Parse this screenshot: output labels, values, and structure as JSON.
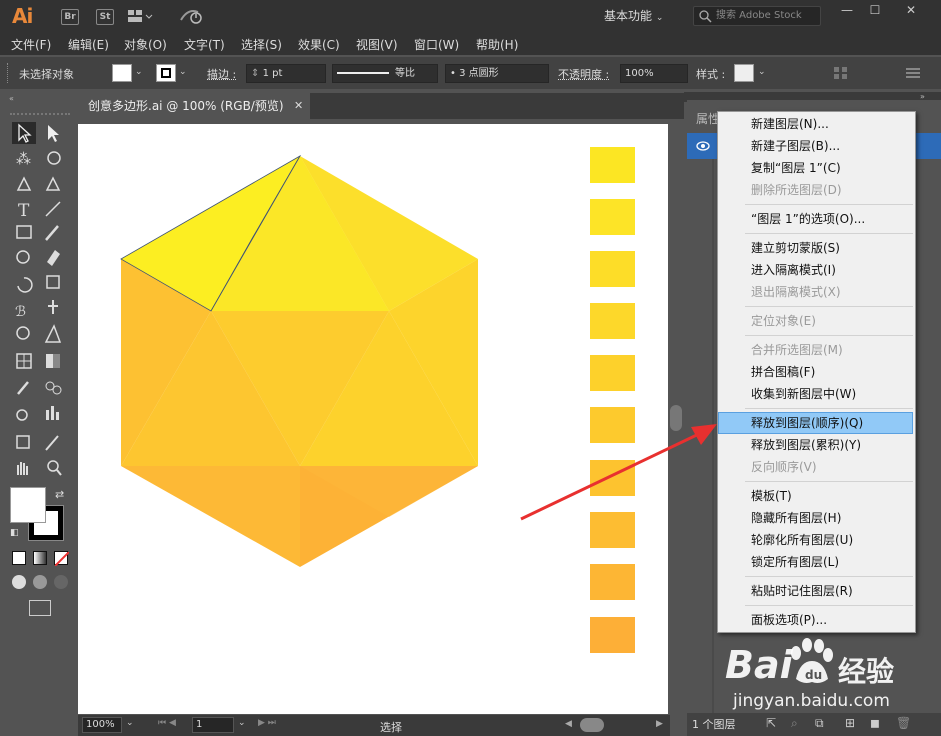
{
  "app": {
    "logo": "Ai",
    "bridge_label": "Br",
    "stock_label": "St",
    "workspace": "基本功能",
    "search_placeholder": "搜索 Adobe Stock",
    "minimize": "—",
    "maximize": "☐",
    "close": "✕"
  },
  "menubar": {
    "items": [
      "文件(F)",
      "编辑(E)",
      "对象(O)",
      "文字(T)",
      "选择(S)",
      "效果(C)",
      "视图(V)",
      "窗口(W)",
      "帮助(H)"
    ]
  },
  "controlbar": {
    "selection_status": "未选择对象",
    "stroke_label": "描边 :",
    "stroke_weight": "1 pt",
    "stroke_profile": "等比",
    "brush": "3 点圆形",
    "opacity_label": "不透明度 :",
    "opacity_value": "100%",
    "style_label": "样式 :"
  },
  "document": {
    "tab_title": "创意多边形.ai @ 100% (RGB/预览)",
    "tab_close": "✕"
  },
  "statusbar": {
    "zoom": "100%",
    "artboard_number": "1",
    "tool_status": "选择"
  },
  "layers_panel": {
    "tab_label": "属性",
    "layer_count": "1 个图层"
  },
  "context_menu": {
    "items": [
      {
        "label": "新建图层(N)...",
        "disabled": false
      },
      {
        "label": "新建子图层(B)...",
        "disabled": false
      },
      {
        "label": "复制“图层 1”(C)",
        "disabled": false
      },
      {
        "label": "删除所选图层(D)",
        "disabled": true
      },
      {
        "label": "“图层 1”的选项(O)...",
        "disabled": false
      },
      {
        "label": "建立剪切蒙版(S)",
        "disabled": false
      },
      {
        "label": "进入隔离模式(I)",
        "disabled": false
      },
      {
        "label": "退出隔离模式(X)",
        "disabled": true
      },
      {
        "label": "定位对象(E)",
        "disabled": true
      },
      {
        "label": "合并所选图层(M)",
        "disabled": true
      },
      {
        "label": "拼合图稿(F)",
        "disabled": false
      },
      {
        "label": "收集到新图层中(W)",
        "disabled": false
      },
      {
        "label": "释放到图层(顺序)(Q)",
        "disabled": false,
        "highlighted": true
      },
      {
        "label": "释放到图层(累积)(Y)",
        "disabled": false
      },
      {
        "label": "反向顺序(V)",
        "disabled": true
      },
      {
        "label": "模板(T)",
        "disabled": false
      },
      {
        "label": "隐藏所有图层(H)",
        "disabled": false
      },
      {
        "label": "轮廓化所有图层(U)",
        "disabled": false
      },
      {
        "label": "锁定所有图层(L)",
        "disabled": false
      },
      {
        "label": "粘贴时记住图层(R)",
        "disabled": false
      },
      {
        "label": "面板选项(P)...",
        "disabled": false
      }
    ]
  },
  "swatch_colors": [
    "#fce623",
    "#fde427",
    "#fddd28",
    "#fdd82a",
    "#fdd12b",
    "#fdca2d",
    "#fdc32f",
    "#fdbd32",
    "#fdb634",
    "#fdaf37"
  ],
  "watermark": {
    "brand_left": "Bai",
    "brand_right": "经验",
    "url": "jingyan.baidu.com"
  },
  "colors": {
    "ui_dark": "#323232",
    "ui_mid": "#535353",
    "highlight": "#91c9f7",
    "layer_blue": "#2d6bb8",
    "arrow": "#e8302f"
  }
}
